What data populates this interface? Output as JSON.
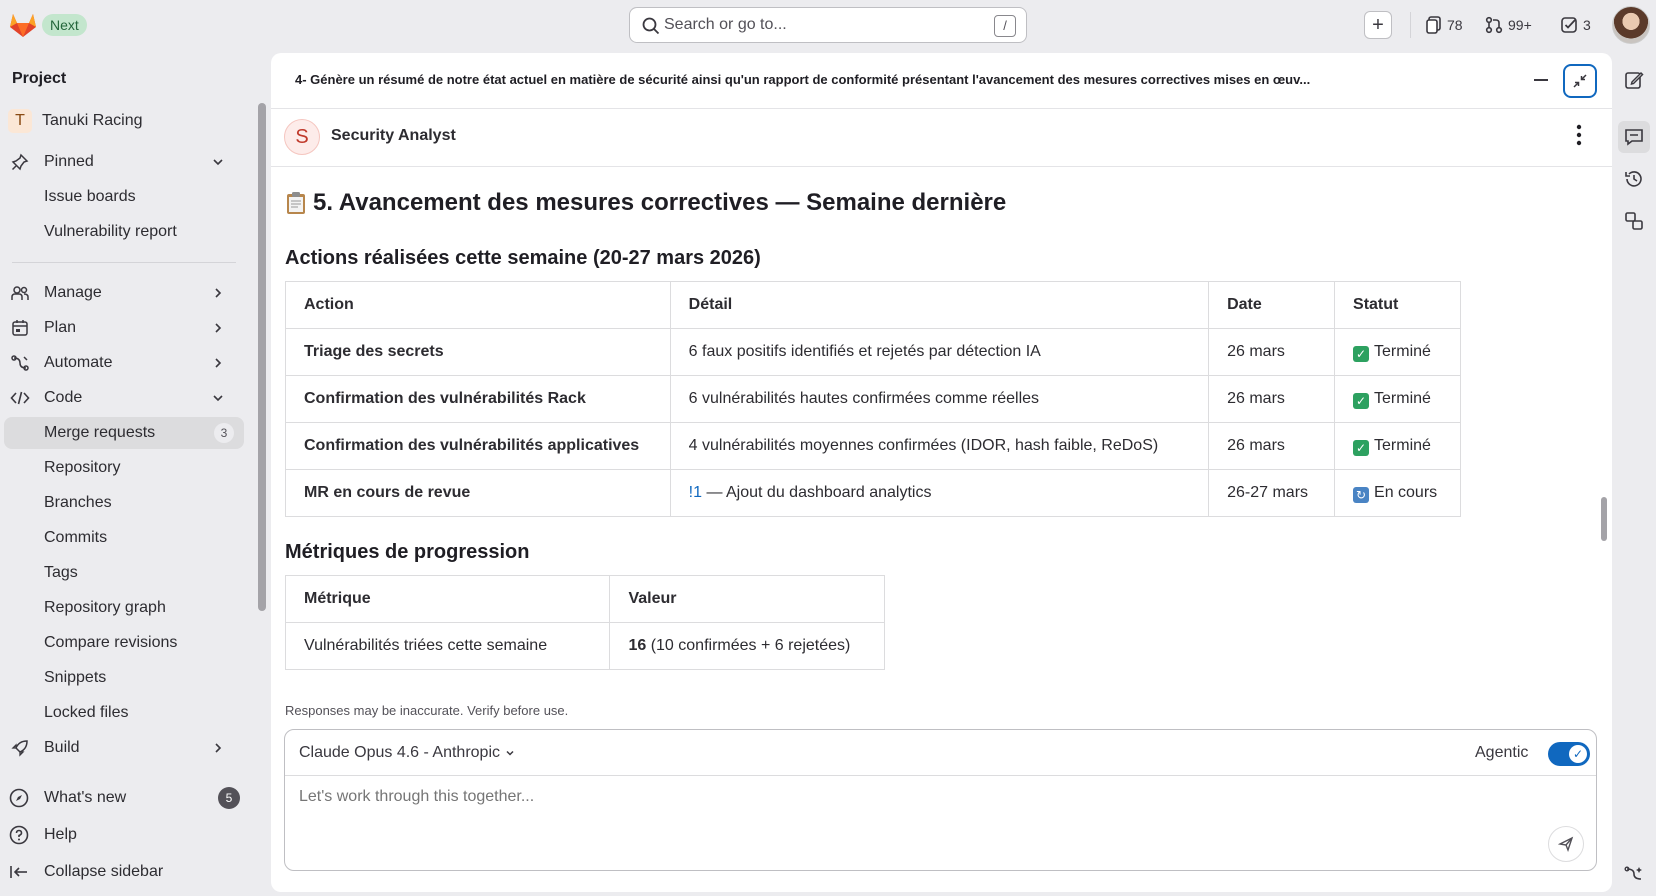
{
  "topbar": {
    "next_badge": "Next",
    "search_placeholder": "Search or go to...",
    "search_shortcut": "/",
    "plus_label": "+",
    "issues_count": "78",
    "merge_requests_count": "99+",
    "todos_count": "3"
  },
  "sidebar": {
    "section_title": "Project",
    "project_initial": "T",
    "project_name": "Tanuki Racing",
    "pinned_label": "Pinned",
    "pinned_items": [
      "Issue boards",
      "Vulnerability report"
    ],
    "nav": {
      "manage": "Manage",
      "plan": "Plan",
      "automate": "Automate",
      "code": "Code",
      "build": "Build"
    },
    "code_items": [
      "Merge requests",
      "Repository",
      "Branches",
      "Commits",
      "Tags",
      "Repository graph",
      "Compare revisions",
      "Snippets",
      "Locked files"
    ],
    "merge_requests_count": "3",
    "bottom": {
      "whats_new": "What's new",
      "whats_new_count": "5",
      "help": "Help",
      "collapse": "Collapse sidebar"
    }
  },
  "panel": {
    "title": "4- Génère un résumé de notre état actuel en matière de sécurité ainsi qu'un rapport de conformité présentant l'avancement des mesures correctives mises en œuv...",
    "agent_initial": "S",
    "agent_name": "Security Analyst"
  },
  "content": {
    "heading": "5. Avancement des mesures correctives — Semaine dernière",
    "actions_heading": "Actions réalisées cette semaine (20-27 mars 2026)",
    "actions_table": {
      "headers": [
        "Action",
        "Détail",
        "Date",
        "Statut"
      ],
      "rows": [
        {
          "action": "Triage des secrets",
          "detail": "6 faux positifs identifiés et rejetés par détection IA",
          "date": "26 mars",
          "status": "Terminé"
        },
        {
          "action": "Confirmation des vulnérabilités Rack",
          "detail": "6 vulnérabilités hautes confirmées comme réelles",
          "date": "26 mars",
          "status": "Terminé"
        },
        {
          "action": "Confirmation des vulnérabilités applicatives",
          "detail": "4 vulnérabilités moyennes confirmées (IDOR, hash faible, ReDoS)",
          "date": "26 mars",
          "status": "Terminé"
        },
        {
          "action": "MR en cours de revue",
          "detail_link": "!1",
          "detail": " — Ajout du dashboard analytics",
          "date": "26-27 mars",
          "status": "En cours"
        }
      ]
    },
    "metrics_heading": "Métriques de progression",
    "metrics_table": {
      "headers": [
        "Métrique",
        "Valeur"
      ],
      "rows": [
        {
          "metric": "Vulnérabilités triées cette semaine",
          "value_bold": "16",
          "value_rest": " (10 confirmées + 6 rejetées)"
        }
      ]
    }
  },
  "chat": {
    "disclaimer": "Responses may be inaccurate. Verify before use.",
    "model": "Claude Opus 4.6 - Anthropic",
    "agentic_label": "Agentic",
    "agentic_enabled": true,
    "input_placeholder": "Let's work through this together..."
  },
  "colors": {
    "accent": "#1068bf",
    "success": "#2da160",
    "background": "#ececef"
  }
}
